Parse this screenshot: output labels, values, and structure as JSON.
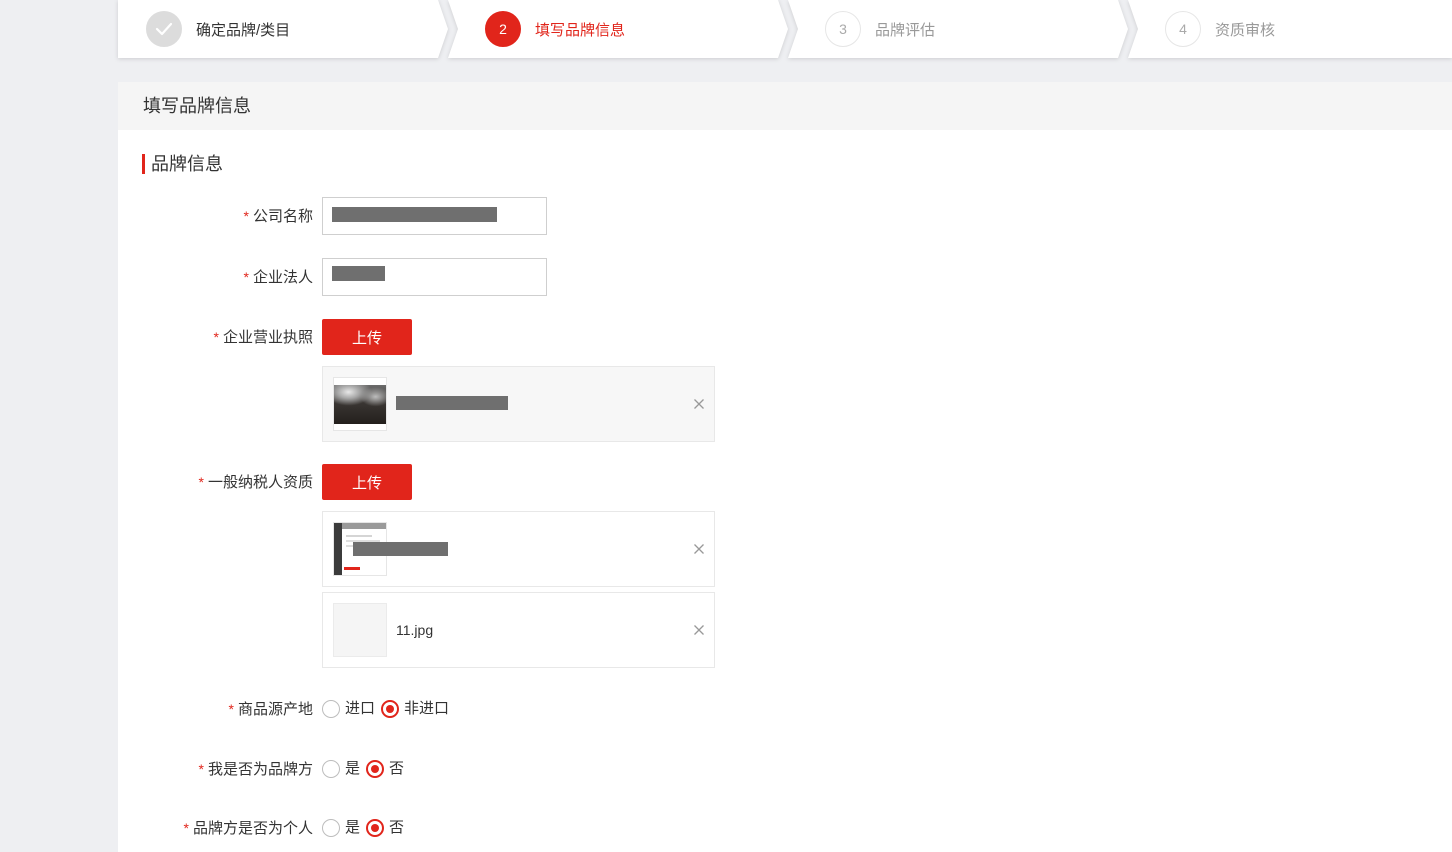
{
  "steps": {
    "current": 2,
    "items": [
      {
        "label": "确定品牌/类目",
        "icon": "check-icon"
      },
      {
        "number": "2",
        "label": "填写品牌信息"
      },
      {
        "number": "3",
        "label": "品牌评估"
      },
      {
        "number": "4",
        "label": "资质审核"
      }
    ]
  },
  "panel": {
    "title": "填写品牌信息"
  },
  "section": {
    "title": "品牌信息"
  },
  "form": {
    "required_mark": "*",
    "company_name": {
      "label": "公司名称"
    },
    "legal_person": {
      "label": "企业法人"
    },
    "business_license": {
      "label": "企业营业执照",
      "upload_label": "上传"
    },
    "taxpayer_qualification": {
      "label": "一般纳税人资质",
      "upload_label": "上传",
      "file_name": "11.jpg"
    },
    "product_origin": {
      "label": "商品源产地",
      "options": [
        "进口",
        "非进口"
      ],
      "selected": 1
    },
    "is_brand_owner": {
      "label": "我是否为品牌方",
      "options": [
        "是",
        "否"
      ],
      "selected": 1
    },
    "brand_owner_is_individual": {
      "label": "品牌方是否为个人",
      "options": [
        "是",
        "否"
      ],
      "selected": 1
    }
  },
  "icons": {
    "step_done": "check-icon",
    "remove_file": "close-icon"
  },
  "colors": {
    "accent": "#e1251b",
    "page_background": "#eeeff2",
    "panel_header": "#f5f5f5"
  }
}
